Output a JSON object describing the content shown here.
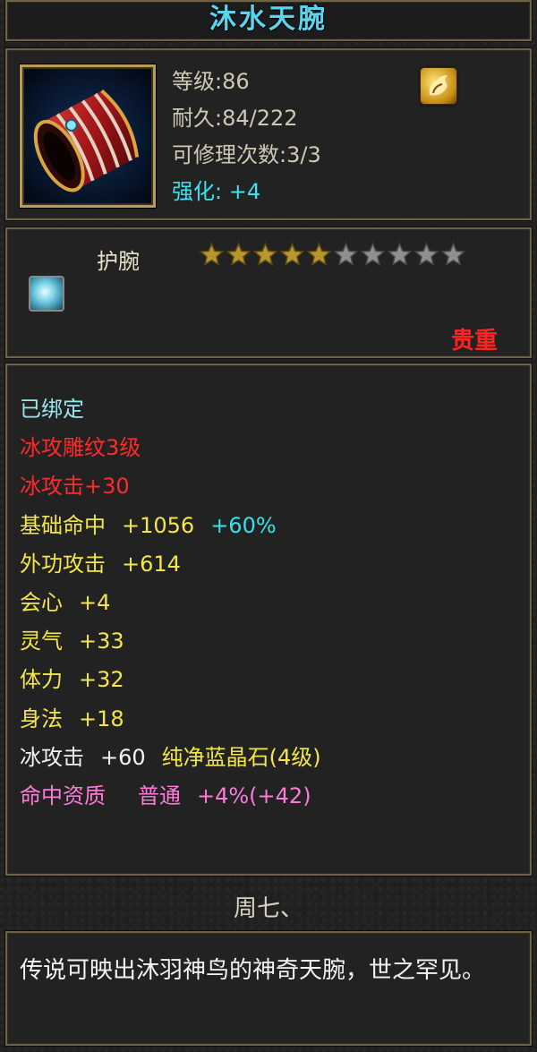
{
  "item": {
    "name": "沐水天腕",
    "level_text": "等级:86",
    "durability_text": "耐久:84/222",
    "repair_text": "可修理次数:3/3",
    "enhance_label": "强化:",
    "enhance_value": "+4",
    "type": "护腕",
    "stars_filled": 5,
    "stars_total": 10,
    "rarity": "贵重",
    "icon": "red-bracer-icon",
    "badge_icon": "gold-dragon-badge-icon",
    "gem_icon": "blue-crystal-gem-icon"
  },
  "stats": {
    "bound": "已绑定",
    "engrave": "冰攻雕纹3级",
    "ice_attack_bonus": "冰攻击+30",
    "hit": {
      "label": "基础命中",
      "value": "+1056",
      "pct": "+60%"
    },
    "outer_attack": {
      "label": "外功攻击",
      "value": "+614"
    },
    "crit": {
      "label": "会心",
      "value": "+4"
    },
    "spirit": {
      "label": "灵气",
      "value": "+33"
    },
    "stamina": {
      "label": "体力",
      "value": "+32"
    },
    "agility": {
      "label": "身法",
      "value": "+18"
    },
    "gem_stat": {
      "label": "冰攻击",
      "value": "+60",
      "gem": "纯净蓝晶石(4级)"
    },
    "aptitude": {
      "label": "命中资质",
      "grade": "普通",
      "value": "+4%(+42)"
    }
  },
  "week": "周七、",
  "description": "传说可映出沐羽神鸟的神奇天腕，世之罕见。",
  "colors": {
    "title": "#58d6f0",
    "red": "#ff2a2a",
    "yellow": "#f4e64a",
    "pink": "#ff7ad8",
    "cyan": "#32e2e8",
    "border": "#6f6347"
  }
}
